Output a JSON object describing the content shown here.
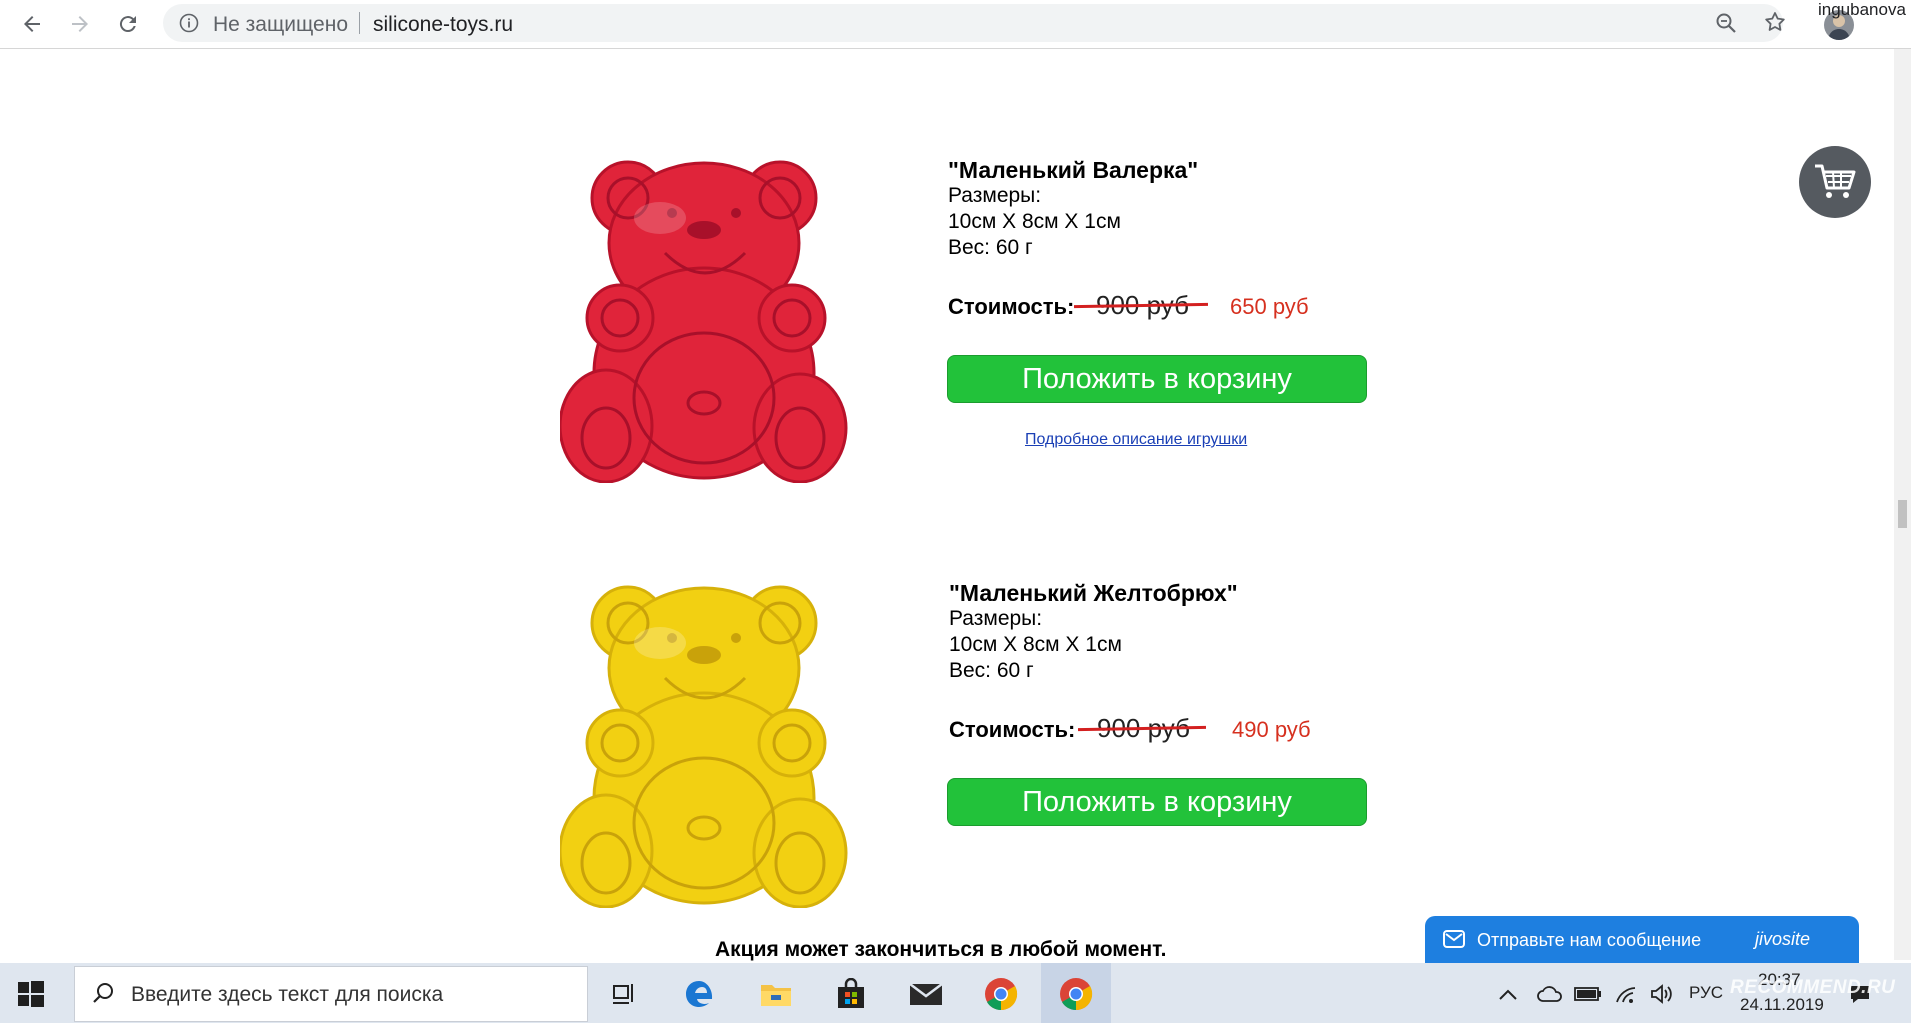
{
  "browser": {
    "security_label": "Не защищено",
    "url": "silicone-toys.ru",
    "profile_name": "ingubanova"
  },
  "products": [
    {
      "title": "\"Маленький Валерка\"",
      "sizes_label": "Размеры:",
      "sizes": "10см Х 8см Х 1см",
      "weight": "Вес: 60 г",
      "cost_label": "Стоимость:",
      "old_price": "900 руб",
      "new_price": "650 руб",
      "button": "Положить в корзину",
      "link": "Подробное описание игрушки",
      "color": "#e0243a"
    },
    {
      "title": "\"Маленький Желтобрюх\"",
      "sizes_label": "Размеры:",
      "sizes": "10см Х 8см Х 1см",
      "weight": "Вес: 60 г",
      "cost_label": "Стоимость:",
      "old_price": "900 руб",
      "new_price": "490 руб",
      "button": "Положить в корзину",
      "color": "#f2d012"
    }
  ],
  "promo": "Акция может закончиться в любой момент.",
  "chat": {
    "text": "Отправьте нам сообщение",
    "brand": "jivosite"
  },
  "taskbar": {
    "search_placeholder": "Введите здесь текст для поиска",
    "language": "РУС",
    "time": "20:37",
    "date": "24.11.2019"
  },
  "watermark": "RECOMMEND.RU"
}
